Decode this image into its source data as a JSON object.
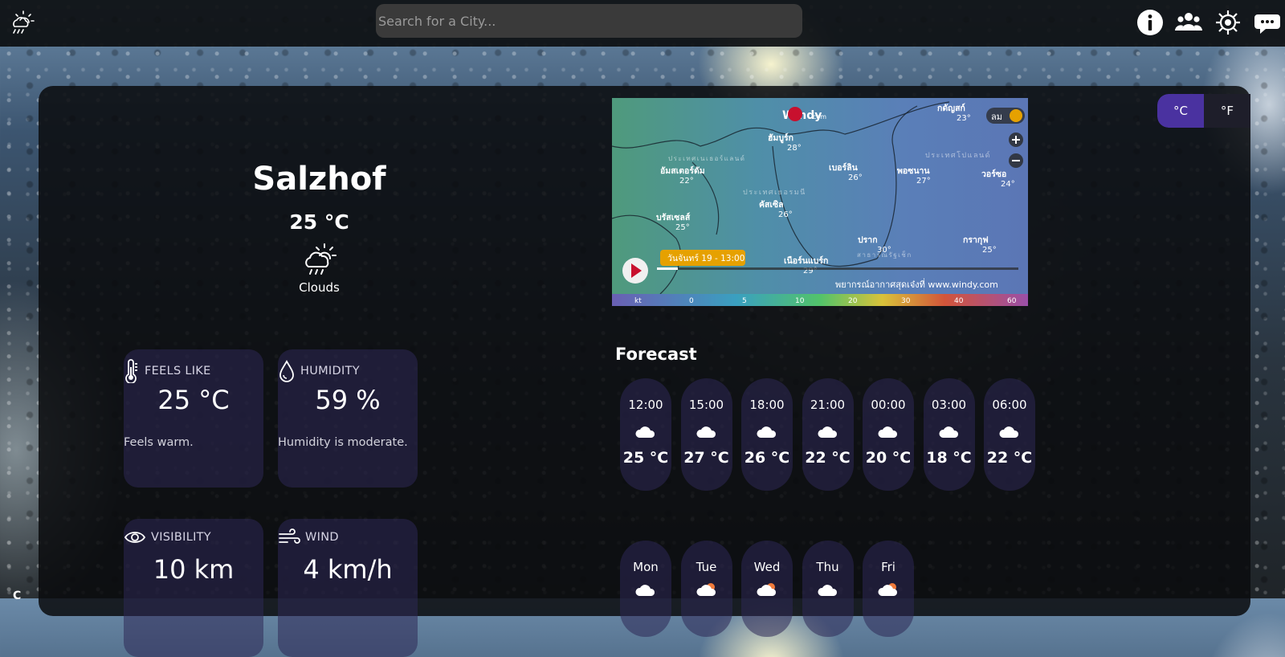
{
  "header": {
    "search_placeholder": "Search for a City...",
    "icons": [
      "cloud-rain-sun-icon",
      "info-icon",
      "users-icon",
      "settings-icon",
      "feedback-icon"
    ]
  },
  "units": {
    "celsius_label": "°C",
    "fahrenheit_label": "°F",
    "selected": "°C"
  },
  "current": {
    "city": "Salzhof",
    "temperature": "25 °C",
    "condition": "Clouds",
    "condition_icon": "partly-cloudy-rain-icon"
  },
  "cards": {
    "feels_like": {
      "title": "FEELS LIKE",
      "value": "25 °C",
      "note": "Feels warm.",
      "icon": "thermometer-icon"
    },
    "humidity": {
      "title": "HUMIDITY",
      "value": "59 %",
      "note": "Humidity is moderate.",
      "icon": "droplet-icon"
    },
    "visibility": {
      "title": "VISIBILITY",
      "value": "10 km",
      "icon": "eye-icon"
    },
    "wind": {
      "title": "WIND",
      "value": "4 km/h",
      "icon": "wind-icon"
    }
  },
  "map": {
    "brand": "Windy",
    "brand_suffix": "com",
    "layer_label": "ลม",
    "time_label": "วันจันทร์ 19 - 13:00",
    "footer_text": "พยากรณ์อากาศสุดเจ๋งที่ www.windy.com",
    "scale_unit": "kt",
    "scale_ticks": [
      "0",
      "5",
      "10",
      "20",
      "30",
      "40",
      "60"
    ],
    "places": [
      {
        "name": "ฮัมบูร์ก",
        "temp": "28°"
      },
      {
        "name": "อัมสเตอร์ดัม",
        "temp": "22°"
      },
      {
        "name": "เบอร์ลิน",
        "temp": "26°"
      },
      {
        "name": "พอซนาน",
        "temp": "27°"
      },
      {
        "name": "กดัญสก์",
        "temp": "23°"
      },
      {
        "name": "วอร์ซอ",
        "temp": "24°"
      },
      {
        "name": "บรัสเซลส์",
        "temp": "25°"
      },
      {
        "name": "คัสเซิล",
        "temp": "26°"
      },
      {
        "name": "ปราก",
        "temp": "30°"
      },
      {
        "name": "กรากุฟ",
        "temp": "25°"
      },
      {
        "name": "เนือร์นแบร์ก",
        "temp": "29°"
      }
    ],
    "regions": [
      "ประเทศเนเธอร์แลนด์",
      "ประเทศเยอรมนี",
      "ประเทศโปแลนด์",
      "สาธารณรัฐเช็ก"
    ]
  },
  "forecast": {
    "title": "Forecast",
    "hourly": [
      {
        "time": "12:00",
        "temp": "25 °C",
        "icon": "cloud-icon"
      },
      {
        "time": "15:00",
        "temp": "27 °C",
        "icon": "cloud-icon"
      },
      {
        "time": "18:00",
        "temp": "26 °C",
        "icon": "cloud-icon"
      },
      {
        "time": "21:00",
        "temp": "22 °C",
        "icon": "cloud-icon"
      },
      {
        "time": "00:00",
        "temp": "20 °C",
        "icon": "cloud-icon"
      },
      {
        "time": "03:00",
        "temp": "18 °C",
        "icon": "cloud-icon"
      },
      {
        "time": "06:00",
        "temp": "22 °C",
        "icon": "cloud-icon"
      }
    ],
    "daily": [
      {
        "day": "Mon",
        "icon": "cloud-icon"
      },
      {
        "day": "Tue",
        "icon": "sun-cloud-icon"
      },
      {
        "day": "Wed",
        "icon": "sun-cloud-icon"
      },
      {
        "day": "Thu",
        "icon": "cloud-icon"
      },
      {
        "day": "Fri",
        "icon": "sun-cloud-icon"
      }
    ]
  },
  "footer": {
    "corner_text": "C"
  }
}
